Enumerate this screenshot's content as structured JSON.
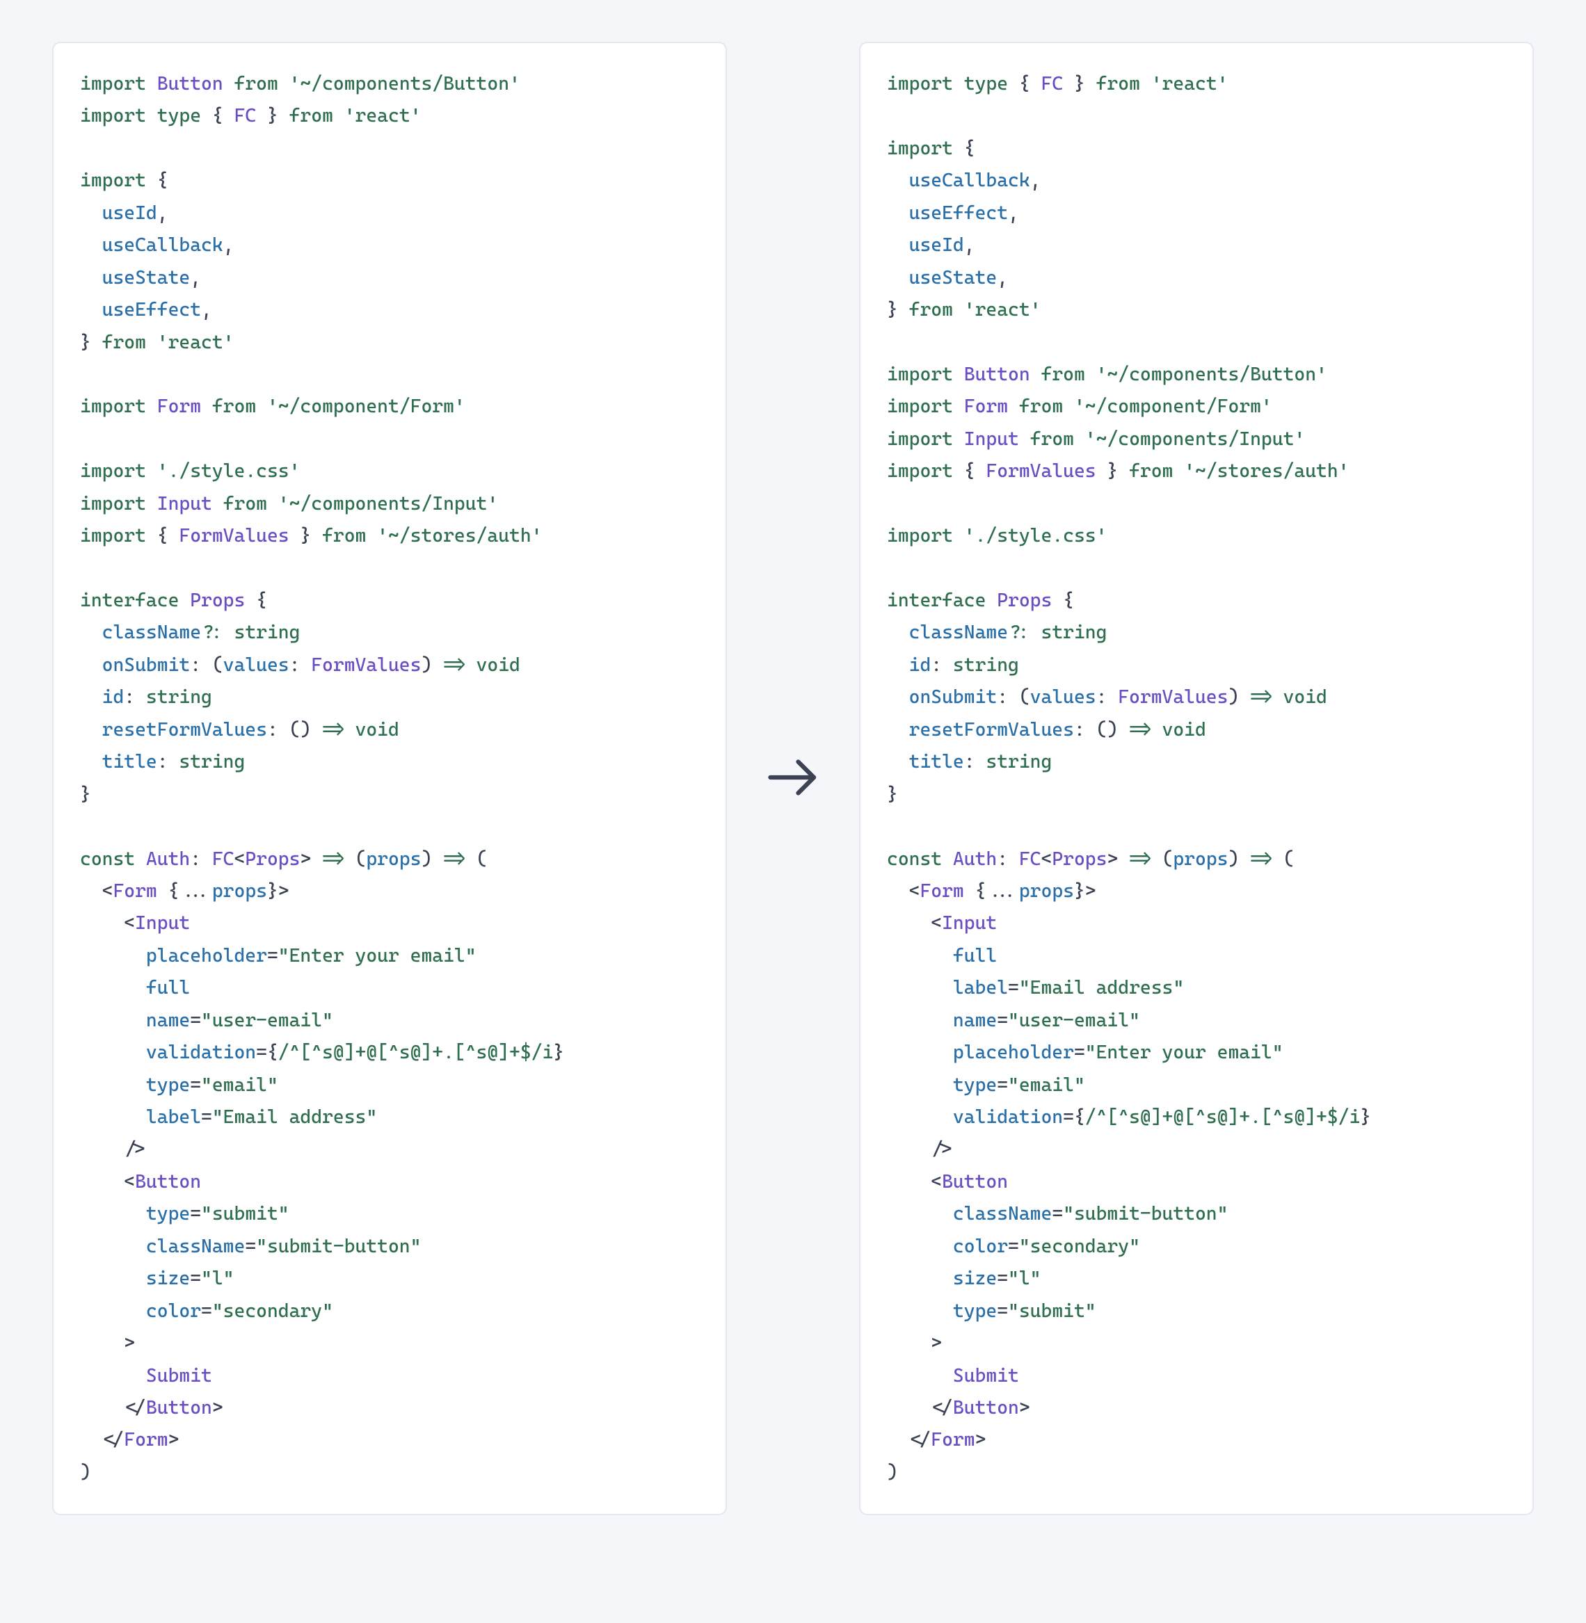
{
  "left": {
    "lines": [
      [
        [
          "kw",
          "import"
        ],
        [
          "pn",
          " "
        ],
        [
          "ty",
          "Button"
        ],
        [
          "pn",
          " "
        ],
        [
          "kw",
          "from"
        ],
        [
          "pn",
          " "
        ],
        [
          "str",
          "'~/components/Button'"
        ]
      ],
      [
        [
          "kw",
          "import"
        ],
        [
          "pn",
          " "
        ],
        [
          "kw",
          "type"
        ],
        [
          "pn",
          " { "
        ],
        [
          "ty",
          "FC"
        ],
        [
          "pn",
          " } "
        ],
        [
          "kw",
          "from"
        ],
        [
          "pn",
          " "
        ],
        [
          "str",
          "'react'"
        ]
      ],
      [],
      [
        [
          "kw",
          "import"
        ],
        [
          "pn",
          " {"
        ]
      ],
      [
        [
          "pn",
          "  "
        ],
        [
          "fn",
          "useId"
        ],
        [
          "pn",
          ","
        ]
      ],
      [
        [
          "pn",
          "  "
        ],
        [
          "fn",
          "useCallback"
        ],
        [
          "pn",
          ","
        ]
      ],
      [
        [
          "pn",
          "  "
        ],
        [
          "fn",
          "useState"
        ],
        [
          "pn",
          ","
        ]
      ],
      [
        [
          "pn",
          "  "
        ],
        [
          "fn",
          "useEffect"
        ],
        [
          "pn",
          ","
        ]
      ],
      [
        [
          "pn",
          "} "
        ],
        [
          "kw",
          "from"
        ],
        [
          "pn",
          " "
        ],
        [
          "str",
          "'react'"
        ]
      ],
      [],
      [
        [
          "kw",
          "import"
        ],
        [
          "pn",
          " "
        ],
        [
          "ty",
          "Form"
        ],
        [
          "pn",
          " "
        ],
        [
          "kw",
          "from"
        ],
        [
          "pn",
          " "
        ],
        [
          "str",
          "'~/component/Form'"
        ]
      ],
      [],
      [
        [
          "kw",
          "import"
        ],
        [
          "pn",
          " "
        ],
        [
          "str",
          "'./style.css'"
        ]
      ],
      [
        [
          "kw",
          "import"
        ],
        [
          "pn",
          " "
        ],
        [
          "ty",
          "Input"
        ],
        [
          "pn",
          " "
        ],
        [
          "kw",
          "from"
        ],
        [
          "pn",
          " "
        ],
        [
          "str",
          "'~/components/Input'"
        ]
      ],
      [
        [
          "kw",
          "import"
        ],
        [
          "pn",
          " { "
        ],
        [
          "ty",
          "FormValues"
        ],
        [
          "pn",
          " } "
        ],
        [
          "kw",
          "from"
        ],
        [
          "pn",
          " "
        ],
        [
          "str",
          "'~/stores/auth'"
        ]
      ],
      [],
      [
        [
          "kw",
          "interface"
        ],
        [
          "pn",
          " "
        ],
        [
          "ty",
          "Props"
        ],
        [
          "pn",
          " {"
        ]
      ],
      [
        [
          "pn",
          "  "
        ],
        [
          "fn",
          "className"
        ],
        [
          "kw",
          "?"
        ],
        [
          "pn",
          ": "
        ],
        [
          "kw",
          "string"
        ]
      ],
      [
        [
          "pn",
          "  "
        ],
        [
          "fn",
          "onSubmit"
        ],
        [
          "pn",
          ": ("
        ],
        [
          "fn",
          "values"
        ],
        [
          "pn",
          ": "
        ],
        [
          "ty",
          "FormValues"
        ],
        [
          "pn",
          ") "
        ],
        [
          "kw",
          "=>"
        ],
        [
          "pn",
          " "
        ],
        [
          "kw",
          "void"
        ]
      ],
      [
        [
          "pn",
          "  "
        ],
        [
          "fn",
          "id"
        ],
        [
          "pn",
          ": "
        ],
        [
          "kw",
          "string"
        ]
      ],
      [
        [
          "pn",
          "  "
        ],
        [
          "fn",
          "resetFormValues"
        ],
        [
          "pn",
          ": () "
        ],
        [
          "kw",
          "=>"
        ],
        [
          "pn",
          " "
        ],
        [
          "kw",
          "void"
        ]
      ],
      [
        [
          "pn",
          "  "
        ],
        [
          "fn",
          "title"
        ],
        [
          "pn",
          ": "
        ],
        [
          "kw",
          "string"
        ]
      ],
      [
        [
          "pn",
          "}"
        ]
      ],
      [],
      [
        [
          "kw",
          "const"
        ],
        [
          "pn",
          " "
        ],
        [
          "ty",
          "Auth"
        ],
        [
          "pn",
          ": "
        ],
        [
          "ty",
          "FC"
        ],
        [
          "pn",
          "<"
        ],
        [
          "ty",
          "Props"
        ],
        [
          "pn",
          "> "
        ],
        [
          "kw",
          "=>"
        ],
        [
          "pn",
          " ("
        ],
        [
          "fn",
          "props"
        ],
        [
          "pn",
          ") "
        ],
        [
          "kw",
          "=>"
        ],
        [
          "pn",
          " ("
        ]
      ],
      [
        [
          "pn",
          "  <"
        ],
        [
          "ty",
          "Form"
        ],
        [
          "pn",
          " {..."
        ],
        [
          "fn",
          "props"
        ],
        [
          "pn",
          "}>"
        ]
      ],
      [
        [
          "pn",
          "    <"
        ],
        [
          "ty",
          "Input"
        ]
      ],
      [
        [
          "pn",
          "      "
        ],
        [
          "at",
          "placeholder"
        ],
        [
          "pn",
          "="
        ],
        [
          "str",
          "\"Enter your email\""
        ]
      ],
      [
        [
          "pn",
          "      "
        ],
        [
          "at",
          "full"
        ]
      ],
      [
        [
          "pn",
          "      "
        ],
        [
          "at",
          "name"
        ],
        [
          "pn",
          "="
        ],
        [
          "str",
          "\"user-email\""
        ]
      ],
      [
        [
          "pn",
          "      "
        ],
        [
          "at",
          "validation"
        ],
        [
          "pn",
          "={"
        ],
        [
          "str",
          "/^[^s@]+@[^s@]+.[^s@]+$/i"
        ],
        [
          "pn",
          "}"
        ]
      ],
      [
        [
          "pn",
          "      "
        ],
        [
          "at",
          "type"
        ],
        [
          "pn",
          "="
        ],
        [
          "str",
          "\"email\""
        ]
      ],
      [
        [
          "pn",
          "      "
        ],
        [
          "at",
          "label"
        ],
        [
          "pn",
          "="
        ],
        [
          "str",
          "\"Email address\""
        ]
      ],
      [
        [
          "pn",
          "    />"
        ]
      ],
      [
        [
          "pn",
          "    <"
        ],
        [
          "ty",
          "Button"
        ]
      ],
      [
        [
          "pn",
          "      "
        ],
        [
          "at",
          "type"
        ],
        [
          "pn",
          "="
        ],
        [
          "str",
          "\"submit\""
        ]
      ],
      [
        [
          "pn",
          "      "
        ],
        [
          "at",
          "className"
        ],
        [
          "pn",
          "="
        ],
        [
          "str",
          "\"submit-button\""
        ]
      ],
      [
        [
          "pn",
          "      "
        ],
        [
          "at",
          "size"
        ],
        [
          "pn",
          "="
        ],
        [
          "str",
          "\"l\""
        ]
      ],
      [
        [
          "pn",
          "      "
        ],
        [
          "at",
          "color"
        ],
        [
          "pn",
          "="
        ],
        [
          "str",
          "\"secondary\""
        ]
      ],
      [
        [
          "pn",
          "    >"
        ]
      ],
      [
        [
          "pn",
          "      "
        ],
        [
          "ty",
          "Submit"
        ]
      ],
      [
        [
          "pn",
          "    </"
        ],
        [
          "ty",
          "Button"
        ],
        [
          "pn",
          ">"
        ]
      ],
      [
        [
          "pn",
          "  </"
        ],
        [
          "ty",
          "Form"
        ],
        [
          "pn",
          ">"
        ]
      ],
      [
        [
          "pn",
          ")"
        ]
      ]
    ]
  },
  "right": {
    "lines": [
      [
        [
          "kw",
          "import"
        ],
        [
          "pn",
          " "
        ],
        [
          "kw",
          "type"
        ],
        [
          "pn",
          " { "
        ],
        [
          "ty",
          "FC"
        ],
        [
          "pn",
          " } "
        ],
        [
          "kw",
          "from"
        ],
        [
          "pn",
          " "
        ],
        [
          "str",
          "'react'"
        ]
      ],
      [],
      [
        [
          "kw",
          "import"
        ],
        [
          "pn",
          " {"
        ]
      ],
      [
        [
          "pn",
          "  "
        ],
        [
          "fn",
          "useCallback"
        ],
        [
          "pn",
          ","
        ]
      ],
      [
        [
          "pn",
          "  "
        ],
        [
          "fn",
          "useEffect"
        ],
        [
          "pn",
          ","
        ]
      ],
      [
        [
          "pn",
          "  "
        ],
        [
          "fn",
          "useId"
        ],
        [
          "pn",
          ","
        ]
      ],
      [
        [
          "pn",
          "  "
        ],
        [
          "fn",
          "useState"
        ],
        [
          "pn",
          ","
        ]
      ],
      [
        [
          "pn",
          "} "
        ],
        [
          "kw",
          "from"
        ],
        [
          "pn",
          " "
        ],
        [
          "str",
          "'react'"
        ]
      ],
      [],
      [
        [
          "kw",
          "import"
        ],
        [
          "pn",
          " "
        ],
        [
          "ty",
          "Button"
        ],
        [
          "pn",
          " "
        ],
        [
          "kw",
          "from"
        ],
        [
          "pn",
          " "
        ],
        [
          "str",
          "'~/components/Button'"
        ]
      ],
      [
        [
          "kw",
          "import"
        ],
        [
          "pn",
          " "
        ],
        [
          "ty",
          "Form"
        ],
        [
          "pn",
          " "
        ],
        [
          "kw",
          "from"
        ],
        [
          "pn",
          " "
        ],
        [
          "str",
          "'~/component/Form'"
        ]
      ],
      [
        [
          "kw",
          "import"
        ],
        [
          "pn",
          " "
        ],
        [
          "ty",
          "Input"
        ],
        [
          "pn",
          " "
        ],
        [
          "kw",
          "from"
        ],
        [
          "pn",
          " "
        ],
        [
          "str",
          "'~/components/Input'"
        ]
      ],
      [
        [
          "kw",
          "import"
        ],
        [
          "pn",
          " { "
        ],
        [
          "ty",
          "FormValues"
        ],
        [
          "pn",
          " } "
        ],
        [
          "kw",
          "from"
        ],
        [
          "pn",
          " "
        ],
        [
          "str",
          "'~/stores/auth'"
        ]
      ],
      [],
      [
        [
          "kw",
          "import"
        ],
        [
          "pn",
          " "
        ],
        [
          "str",
          "'./style.css'"
        ]
      ],
      [],
      [
        [
          "kw",
          "interface"
        ],
        [
          "pn",
          " "
        ],
        [
          "ty",
          "Props"
        ],
        [
          "pn",
          " {"
        ]
      ],
      [
        [
          "pn",
          "  "
        ],
        [
          "fn",
          "className"
        ],
        [
          "kw",
          "?"
        ],
        [
          "pn",
          ": "
        ],
        [
          "kw",
          "string"
        ]
      ],
      [
        [
          "pn",
          "  "
        ],
        [
          "fn",
          "id"
        ],
        [
          "pn",
          ": "
        ],
        [
          "kw",
          "string"
        ]
      ],
      [
        [
          "pn",
          "  "
        ],
        [
          "fn",
          "onSubmit"
        ],
        [
          "pn",
          ": ("
        ],
        [
          "fn",
          "values"
        ],
        [
          "pn",
          ": "
        ],
        [
          "ty",
          "FormValues"
        ],
        [
          "pn",
          ") "
        ],
        [
          "kw",
          "=>"
        ],
        [
          "pn",
          " "
        ],
        [
          "kw",
          "void"
        ]
      ],
      [
        [
          "pn",
          "  "
        ],
        [
          "fn",
          "resetFormValues"
        ],
        [
          "pn",
          ": () "
        ],
        [
          "kw",
          "=>"
        ],
        [
          "pn",
          " "
        ],
        [
          "kw",
          "void"
        ]
      ],
      [
        [
          "pn",
          "  "
        ],
        [
          "fn",
          "title"
        ],
        [
          "pn",
          ": "
        ],
        [
          "kw",
          "string"
        ]
      ],
      [
        [
          "pn",
          "}"
        ]
      ],
      [],
      [
        [
          "kw",
          "const"
        ],
        [
          "pn",
          " "
        ],
        [
          "ty",
          "Auth"
        ],
        [
          "pn",
          ": "
        ],
        [
          "ty",
          "FC"
        ],
        [
          "pn",
          "<"
        ],
        [
          "ty",
          "Props"
        ],
        [
          "pn",
          "> "
        ],
        [
          "kw",
          "=>"
        ],
        [
          "pn",
          " ("
        ],
        [
          "fn",
          "props"
        ],
        [
          "pn",
          ") "
        ],
        [
          "kw",
          "=>"
        ],
        [
          "pn",
          " ("
        ]
      ],
      [
        [
          "pn",
          "  <"
        ],
        [
          "ty",
          "Form"
        ],
        [
          "pn",
          " {..."
        ],
        [
          "fn",
          "props"
        ],
        [
          "pn",
          "}>"
        ]
      ],
      [
        [
          "pn",
          "    <"
        ],
        [
          "ty",
          "Input"
        ]
      ],
      [
        [
          "pn",
          "      "
        ],
        [
          "at",
          "full"
        ]
      ],
      [
        [
          "pn",
          "      "
        ],
        [
          "at",
          "label"
        ],
        [
          "pn",
          "="
        ],
        [
          "str",
          "\"Email address\""
        ]
      ],
      [
        [
          "pn",
          "      "
        ],
        [
          "at",
          "name"
        ],
        [
          "pn",
          "="
        ],
        [
          "str",
          "\"user-email\""
        ]
      ],
      [
        [
          "pn",
          "      "
        ],
        [
          "at",
          "placeholder"
        ],
        [
          "pn",
          "="
        ],
        [
          "str",
          "\"Enter your email\""
        ]
      ],
      [
        [
          "pn",
          "      "
        ],
        [
          "at",
          "type"
        ],
        [
          "pn",
          "="
        ],
        [
          "str",
          "\"email\""
        ]
      ],
      [
        [
          "pn",
          "      "
        ],
        [
          "at",
          "validation"
        ],
        [
          "pn",
          "={"
        ],
        [
          "str",
          "/^[^s@]+@[^s@]+.[^s@]+$/i"
        ],
        [
          "pn",
          "}"
        ]
      ],
      [
        [
          "pn",
          "    />"
        ]
      ],
      [
        [
          "pn",
          "    <"
        ],
        [
          "ty",
          "Button"
        ]
      ],
      [
        [
          "pn",
          "      "
        ],
        [
          "at",
          "className"
        ],
        [
          "pn",
          "="
        ],
        [
          "str",
          "\"submit-button\""
        ]
      ],
      [
        [
          "pn",
          "      "
        ],
        [
          "at",
          "color"
        ],
        [
          "pn",
          "="
        ],
        [
          "str",
          "\"secondary\""
        ]
      ],
      [
        [
          "pn",
          "      "
        ],
        [
          "at",
          "size"
        ],
        [
          "pn",
          "="
        ],
        [
          "str",
          "\"l\""
        ]
      ],
      [
        [
          "pn",
          "      "
        ],
        [
          "at",
          "type"
        ],
        [
          "pn",
          "="
        ],
        [
          "str",
          "\"submit\""
        ]
      ],
      [
        [
          "pn",
          "    >"
        ]
      ],
      [
        [
          "pn",
          "      "
        ],
        [
          "ty",
          "Submit"
        ]
      ],
      [
        [
          "pn",
          "    </"
        ],
        [
          "ty",
          "Button"
        ],
        [
          "pn",
          ">"
        ]
      ],
      [
        [
          "pn",
          "  </"
        ],
        [
          "ty",
          "Form"
        ],
        [
          "pn",
          ">"
        ]
      ],
      [
        [
          "pn",
          ")"
        ]
      ]
    ]
  }
}
